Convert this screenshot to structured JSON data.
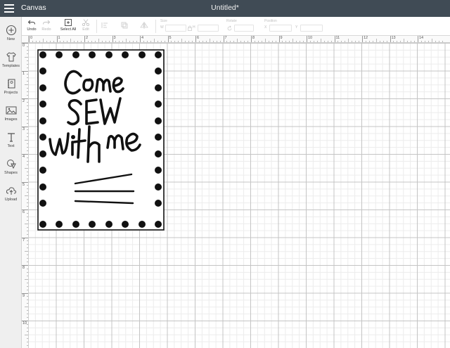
{
  "app": {
    "name": "Canvas",
    "document_title": "Untitled*"
  },
  "left_panel": {
    "items": [
      {
        "label": "New",
        "icon": "plus-circle-icon"
      },
      {
        "label": "Templates",
        "icon": "tshirt-icon"
      },
      {
        "label": "Projects",
        "icon": "projects-icon"
      },
      {
        "label": "Images",
        "icon": "image-icon"
      },
      {
        "label": "Text",
        "icon": "text-icon"
      },
      {
        "label": "Shapes",
        "icon": "shapes-icon"
      },
      {
        "label": "Upload",
        "icon": "upload-icon"
      }
    ]
  },
  "toolbar": {
    "undo": "Undo",
    "redo": "Redo",
    "select_all": "Select All",
    "edit": "Edit",
    "size_label": "Size",
    "w": "W",
    "h": "H",
    "rotate_label": "Rotate",
    "position_label": "Position",
    "x": "X",
    "y": "Y"
  },
  "ruler": {
    "top": [
      "0",
      "1",
      "2",
      "3",
      "4",
      "5",
      "6",
      "7",
      "8",
      "9",
      "10",
      "11",
      "12",
      "13",
      "14"
    ],
    "left": [
      "0",
      "1",
      "2",
      "3",
      "4",
      "5",
      "6",
      "7",
      "8",
      "9",
      "10"
    ]
  },
  "design": {
    "text_lines": [
      "Come",
      "SEW",
      "With me"
    ],
    "stroke_color": "#111111",
    "border_color": "#111111"
  }
}
